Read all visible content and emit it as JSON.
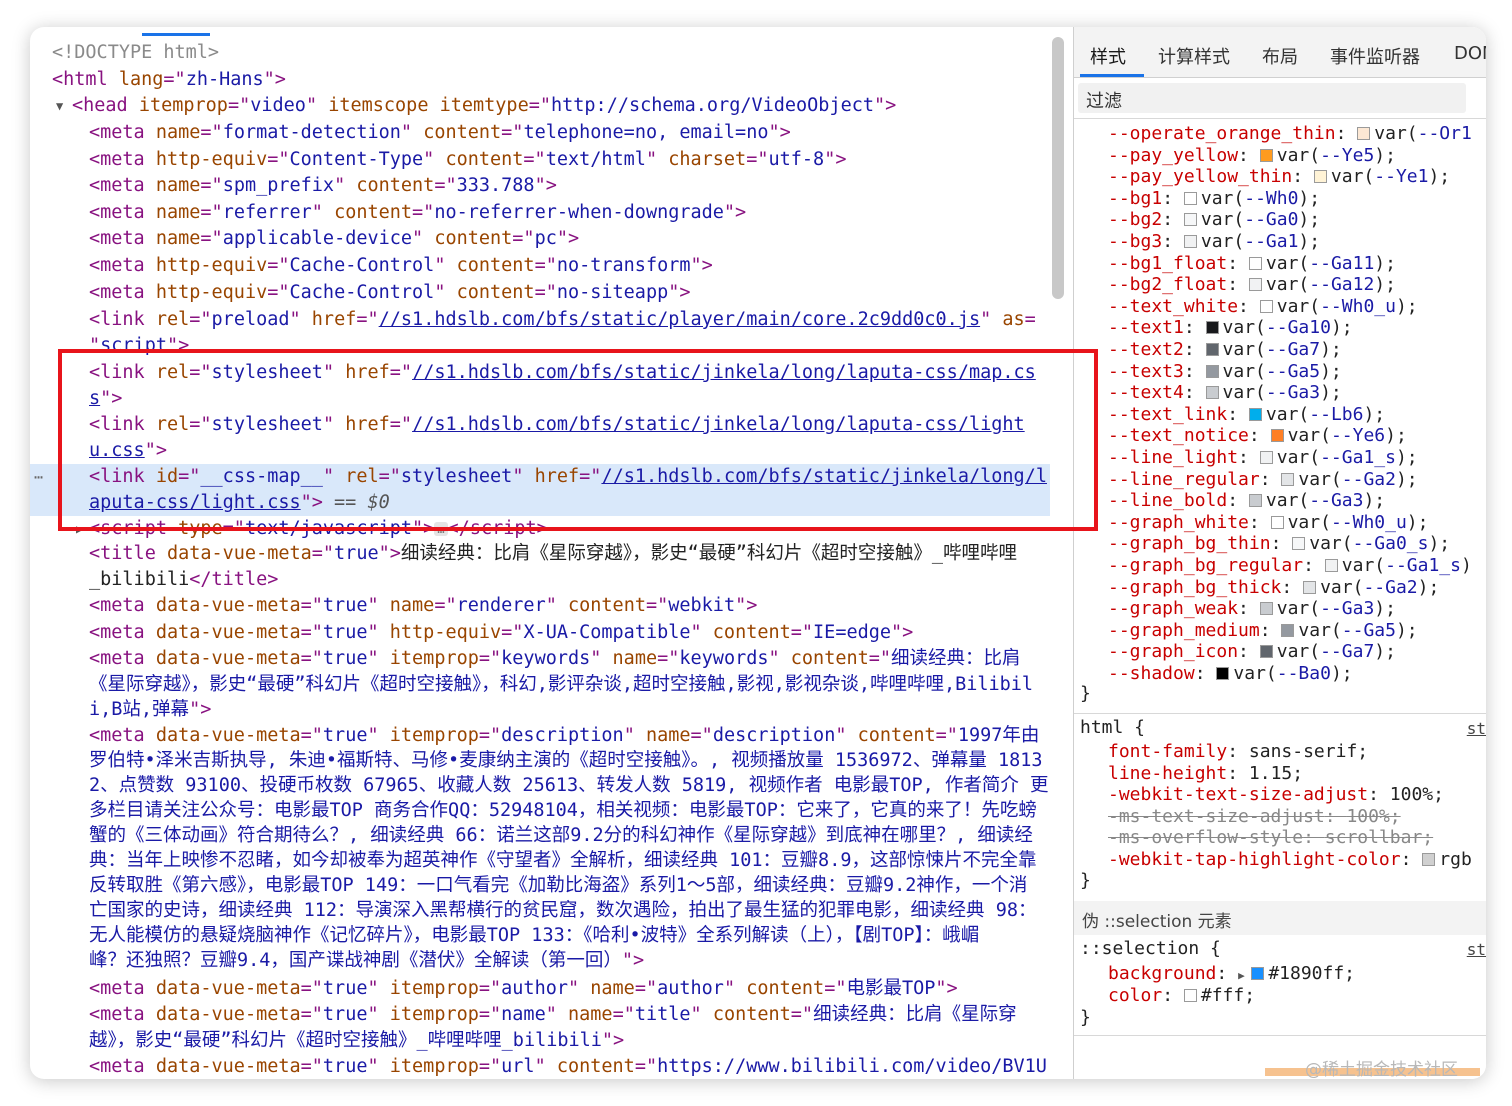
{
  "elements": {
    "doctype": "<!DOCTYPE html>",
    "html_open": {
      "tag": "html",
      "attr": "lang",
      "val": "zh-Hans"
    },
    "head_open": {
      "tag": "head",
      "a1": "itemprop",
      "v1": "video",
      "a2": "itemscope",
      "a3": "itemtype",
      "v3": "http://schema.org/VideoObject"
    },
    "metas": [
      {
        "a1": "name",
        "v1": "format-detection",
        "a2": "content",
        "v2": "telephone=no, email=no"
      },
      {
        "a1": "http-equiv",
        "v1": "Content-Type",
        "a2": "content",
        "v2": "text/html",
        "a3": "charset",
        "v3": "utf-8"
      },
      {
        "a1": "name",
        "v1": "spm_prefix",
        "a2": "content",
        "v2": "333.788"
      },
      {
        "a1": "name",
        "v1": "referrer",
        "a2": "content",
        "v2": "no-referrer-when-downgrade"
      },
      {
        "a1": "name",
        "v1": "applicable-device",
        "a2": "content",
        "v2": "pc"
      },
      {
        "a1": "http-equiv",
        "v1": "Cache-Control",
        "a2": "content",
        "v2": "no-transform"
      },
      {
        "a1": "http-equiv",
        "v1": "Cache-Control",
        "a2": "content",
        "v2": "no-siteapp"
      }
    ],
    "preload": {
      "rel": "preload",
      "href": "//s1.hdslb.com/bfs/static/player/main/core.2c9dd0c0.js",
      "as_attr": "as",
      "as_val": "script"
    },
    "stylesheet1": {
      "rel": "stylesheet",
      "href1": "//s1.hdslb.com/bfs/static/jinkela/long/laputa-css/map.cs",
      "href2": "s"
    },
    "stylesheet2": {
      "rel": "stylesheet",
      "href1": "//s1.hdslb.com/bfs/static/jinkela/long/laputa-css/light",
      "href2": "u.css"
    },
    "stylesheet3": {
      "id": "__css-map__",
      "rel": "stylesheet",
      "href1": "//s1.hdslb.com/bfs/static/jinkela/long/l",
      "href2": "aputa-css/light.css",
      "selected_suffix": "== $0"
    },
    "script_collapsed": {
      "type": "text/javascript",
      "dots": "…"
    },
    "title": {
      "attr": "data-vue-meta",
      "val": "true",
      "text1": "细读经典：比肩《星际穿越》，影史“最硬”科幻片《超时空接触》_哔哩哔哩",
      "text2": "_bilibili"
    },
    "vue_metas": [
      {
        "a1": "name",
        "v1": "renderer",
        "a2": "content",
        "v2": "webkit"
      },
      {
        "a1": "http-equiv",
        "v1": "X-UA-Compatible",
        "a2": "content",
        "v2": "IE=edge"
      }
    ],
    "keywords": {
      "l1_v": "keywords",
      "l1_content": "细读经典：比肩",
      "l2": "《星际穿越》，影史“最硬”科幻片《超时空接触》，科幻,影评杂谈,超时空接触,影视,影视杂谈,哔哩哔哩,Bilibil",
      "l3": "i,B站,弹幕"
    },
    "description": {
      "l1_content": "1997年由",
      "lines": [
        "罗伯特•泽米吉斯执导, 朱迪•福斯特、马修•麦康纳主演的《超时空接触》。, 视频播放量 1536972、弹幕量 1813",
        "2、点赞数 93100、投硬币枚数 67965、收藏人数 25613、转发人数 5819, 视频作者 电影最TOP, 作者简介 更",
        "多栏目请关注公众号：电影最TOP  商务合作QQ：52948104，相关视频：电影最TOP：它来了，它真的来了！先吃螃",
        "蟹的《三体动画》符合期待么？, 细读经典 66：诺兰这部9.2分的科幻神作《星际穿越》到底神在哪里？, 细读经",
        "典：当年上映惨不忍睹，如今却被奉为超英神作《守望者》全解析，细读经典 101：豆瓣8.9，这部惊悚片不完全靠",
        "反转取胜《第六感》，电影最TOP 149：一口气看完《加勒比海盗》系列1～5部，细读经典：豆瓣9.2神作，一个消",
        "亡国家的史诗，细读经典 112：导演深入黑帮横行的贫民窟，数次遇险，拍出了最生猛的犯罪电影，细读经典 98：",
        "无人能模仿的悬疑烧脑神作《记忆碎片》，电影最TOP 133：《哈利•波特》全系列解读（上），【剧TOP】：峨嵋",
        "峰？还独照？豆瓣9.4，国产谍战神剧《潜伏》全解读（第一回）"
      ]
    },
    "author": {
      "v": "author",
      "content": "电影最TOP"
    },
    "name_meta": {
      "v": "name",
      "name_v": "title",
      "content1": "细读经典：比肩《星际穿",
      "content2": "越》，影史“最硬”科幻片《超时空接触》_哔哩哔哩_bilibili"
    },
    "url_meta": {
      "v": "url",
      "content": "https://www.bilibili.com/video/BV1U"
    }
  },
  "styles": {
    "tabs": [
      "样式",
      "计算样式",
      "布局",
      "事件监听器",
      "DOM"
    ],
    "filter_placeholder": "过滤",
    "vars": [
      {
        "name": "--operate_orange_thin",
        "color": "#fde8d4",
        "var": "--Or1",
        "tail": ""
      },
      {
        "name": "--pay_yellow",
        "color": "#ff9b1f",
        "var": "--Ye5",
        "tail": ");"
      },
      {
        "name": "--pay_yellow_thin",
        "color": "#fff3d6",
        "var": "--Ye1",
        "tail": ");"
      },
      {
        "name": "--bg1",
        "color": "#ffffff",
        "var": "--Wh0",
        "tail": ");"
      },
      {
        "name": "--bg2",
        "color": "#f6f7f8",
        "var": "--Ga0",
        "tail": ");"
      },
      {
        "name": "--bg3",
        "color": "#f1f2f3",
        "var": "--Ga1",
        "tail": ");"
      },
      {
        "name": "--bg1_float",
        "color": "#ffffff",
        "var": "--Ga11",
        "tail": ");"
      },
      {
        "name": "--bg2_float",
        "color": "#f1f2f3",
        "var": "--Ga12",
        "tail": ");"
      },
      {
        "name": "--text_white",
        "color": "#ffffff",
        "var": "--Wh0_u",
        "tail": ");"
      },
      {
        "name": "--text1",
        "color": "#18191c",
        "var": "--Ga10",
        "tail": ");"
      },
      {
        "name": "--text2",
        "color": "#61666d",
        "var": "--Ga7",
        "tail": ");"
      },
      {
        "name": "--text3",
        "color": "#9499a0",
        "var": "--Ga5",
        "tail": ");"
      },
      {
        "name": "--text4",
        "color": "#c9ccd0",
        "var": "--Ga3",
        "tail": ");"
      },
      {
        "name": "--text_link",
        "color": "#00aeec",
        "var": "--Lb6",
        "tail": ");"
      },
      {
        "name": "--text_notice",
        "color": "#ff7f24",
        "var": "--Ye6",
        "tail": ");"
      },
      {
        "name": "--line_light",
        "color": "#f1f2f3",
        "var": "--Ga1_s",
        "tail": ");"
      },
      {
        "name": "--line_regular",
        "color": "#e3e5e7",
        "var": "--Ga2",
        "tail": ");"
      },
      {
        "name": "--line_bold",
        "color": "#c9ccd0",
        "var": "--Ga3",
        "tail": ");"
      },
      {
        "name": "--graph_white",
        "color": "#ffffff",
        "var": "--Wh0_u",
        "tail": ");"
      },
      {
        "name": "--graph_bg_thin",
        "color": "#f6f7f8",
        "var": "--Ga0_s",
        "tail": ");"
      },
      {
        "name": "--graph_bg_regular",
        "color": "#f1f2f3",
        "var": "--Ga1_s",
        "tail": ")"
      },
      {
        "name": "--graph_bg_thick",
        "color": "#e3e5e7",
        "var": "--Ga2",
        "tail": ");"
      },
      {
        "name": "--graph_weak",
        "color": "#c9ccd0",
        "var": "--Ga3",
        "tail": ");"
      },
      {
        "name": "--graph_medium",
        "color": "#9499a0",
        "var": "--Ga5",
        "tail": ");"
      },
      {
        "name": "--graph_icon",
        "color": "#61666d",
        "var": "--Ga7",
        "tail": ");"
      },
      {
        "name": "--shadow",
        "color": "#000000",
        "var": "--Ba0",
        "tail": ");"
      }
    ],
    "html_rule": {
      "selector": "html {",
      "source": "st",
      "props": [
        {
          "name": "font-family",
          "value": "sans-serif;",
          "struck": false
        },
        {
          "name": "line-height",
          "value": "1.15;",
          "struck": false
        },
        {
          "name": "-webkit-text-size-adjust",
          "value": "100%;",
          "struck": false
        },
        {
          "name": "-ms-text-size-adjust",
          "value": "100%;",
          "struck": true
        },
        {
          "name": "-ms-overflow-style",
          "value": "scrollbar;",
          "struck": true
        },
        {
          "name": "-webkit-tap-highlight-color",
          "value": "rgb",
          "struck": false,
          "swatch": "#d0d0d0"
        }
      ]
    },
    "pseudo_header": "伪 ::selection 元素",
    "selection_rule": {
      "selector": "::selection {",
      "source": "st",
      "bg_name": "background",
      "bg_color": "#1890ff",
      "bg_value": "#1890ff;",
      "color_name": "color",
      "color_swatch": "#ffffff",
      "color_value": "#fff;"
    },
    "close_brace": "}"
  },
  "watermark": "@稀土掘金技术社区"
}
